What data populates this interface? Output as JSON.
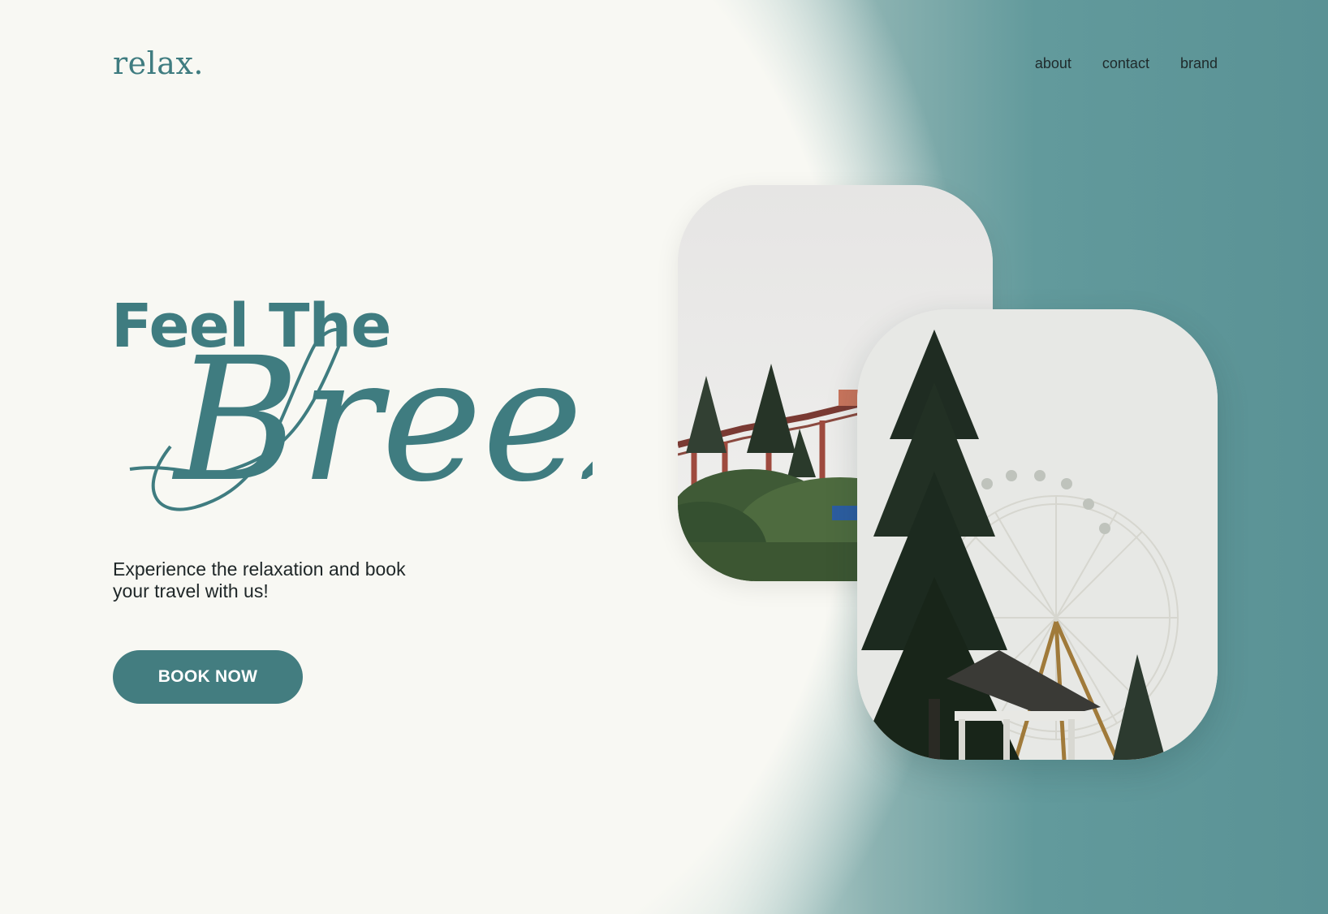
{
  "brand": {
    "logo": "relax."
  },
  "nav": {
    "items": [
      "about",
      "contact",
      "brand"
    ]
  },
  "hero": {
    "headline": "Feel The",
    "script_word": "Breeze",
    "subtitle": "Experience the relaxation and book your travel with us!",
    "cta_label": "BOOK NOW"
  },
  "colors": {
    "accent": "#3f7c80",
    "background": "#f8f8f3",
    "gradient_end": "#5a9295",
    "button": "#437d80"
  },
  "images": {
    "back_photo": "roller-coaster-trees-photo",
    "front_photo": "ferris-wheel-pine-tree-photo"
  }
}
